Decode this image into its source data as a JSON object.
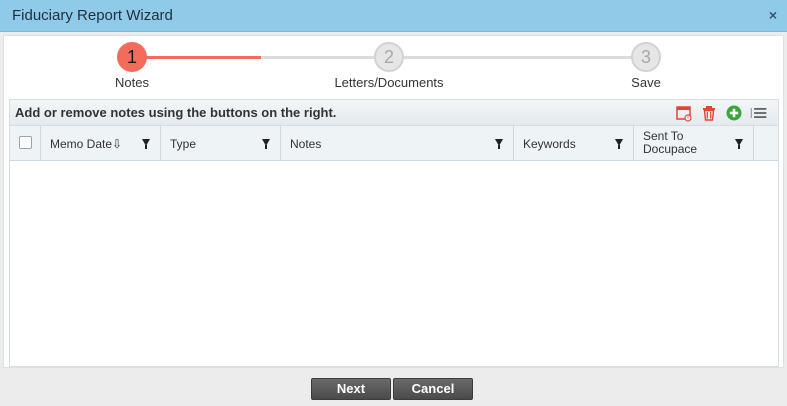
{
  "window": {
    "title": "Fiduciary Report Wizard",
    "close_glyph": "×"
  },
  "stepper": {
    "steps": [
      {
        "number": "1",
        "label": "Notes",
        "state": "active"
      },
      {
        "number": "2",
        "label": "Letters/Documents",
        "state": "inactive"
      },
      {
        "number": "3",
        "label": "Save",
        "state": "inactive"
      }
    ],
    "progress_fraction": 0.25
  },
  "panel": {
    "instruction": "Add or remove notes using the buttons on the right.",
    "toolbar_icons": [
      "calendar-icon",
      "trash-icon",
      "add-icon",
      "menu-icon"
    ]
  },
  "grid": {
    "columns": [
      {
        "label": "Memo Date⇩"
      },
      {
        "label": "Type"
      },
      {
        "label": "Notes"
      },
      {
        "label": "Keywords"
      },
      {
        "label": "Sent To Docupace"
      }
    ],
    "rows": []
  },
  "footer": {
    "next_label": "Next",
    "cancel_label": "Cancel"
  },
  "colors": {
    "titlebar": "#8fcbe9",
    "accent": "#f26b5b",
    "add_green": "#3aa63a",
    "delete_red": "#e0443a"
  }
}
